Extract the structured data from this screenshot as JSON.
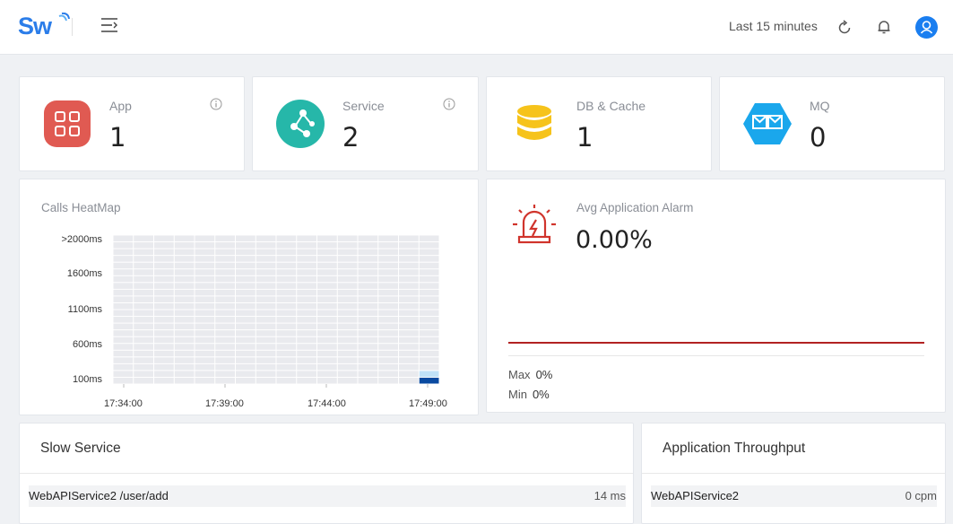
{
  "header": {
    "logo_text": "Sw",
    "time_range": "Last 15 minutes"
  },
  "stats": [
    {
      "label": "App",
      "value": "1",
      "icon": "app-grid-icon",
      "color": "#e05a52"
    },
    {
      "label": "Service",
      "value": "2",
      "icon": "service-node-icon",
      "color": "#26b7a9"
    },
    {
      "label": "DB & Cache",
      "value": "1",
      "icon": "database-icon",
      "color": "#f6c31b"
    },
    {
      "label": "MQ",
      "value": "0",
      "icon": "mq-envelope-icon",
      "color": "#1aa7ec"
    }
  ],
  "heatmap": {
    "title": "Calls HeatMap",
    "y_labels": [
      ">2000ms",
      "1600ms",
      "1100ms",
      "600ms",
      "100ms"
    ],
    "x_labels": [
      "17:34:00",
      "17:39:00",
      "17:44:00",
      "17:49:00"
    ],
    "chart_data": {
      "type": "heatmap",
      "title": "Calls HeatMap",
      "x": [
        "17:34:00",
        "17:39:00",
        "17:44:00",
        "17:49:00"
      ],
      "y": [
        ">2000ms",
        "1600ms",
        "1100ms",
        "600ms",
        "100ms"
      ],
      "cells": [
        {
          "col": 15,
          "row": 0,
          "level": "high"
        },
        {
          "col": 15,
          "row": 1,
          "level": "low"
        }
      ],
      "colors": {
        "empty": "#e9eaee",
        "low": "#bfe1f7",
        "high": "#0a4aa0"
      }
    }
  },
  "alarm": {
    "title": "Avg Application Alarm",
    "value": "0.00%",
    "max_label": "Max",
    "max_value": "0%",
    "min_label": "Min",
    "min_value": "0%",
    "color": "#d0342c"
  },
  "slow_service": {
    "title": "Slow Service",
    "rows": [
      {
        "name": "WebAPIService2 /user/add",
        "value": "14 ms"
      }
    ]
  },
  "throughput": {
    "title": "Application Throughput",
    "rows": [
      {
        "name": "WebAPIService2",
        "value": "0 cpm"
      }
    ]
  }
}
